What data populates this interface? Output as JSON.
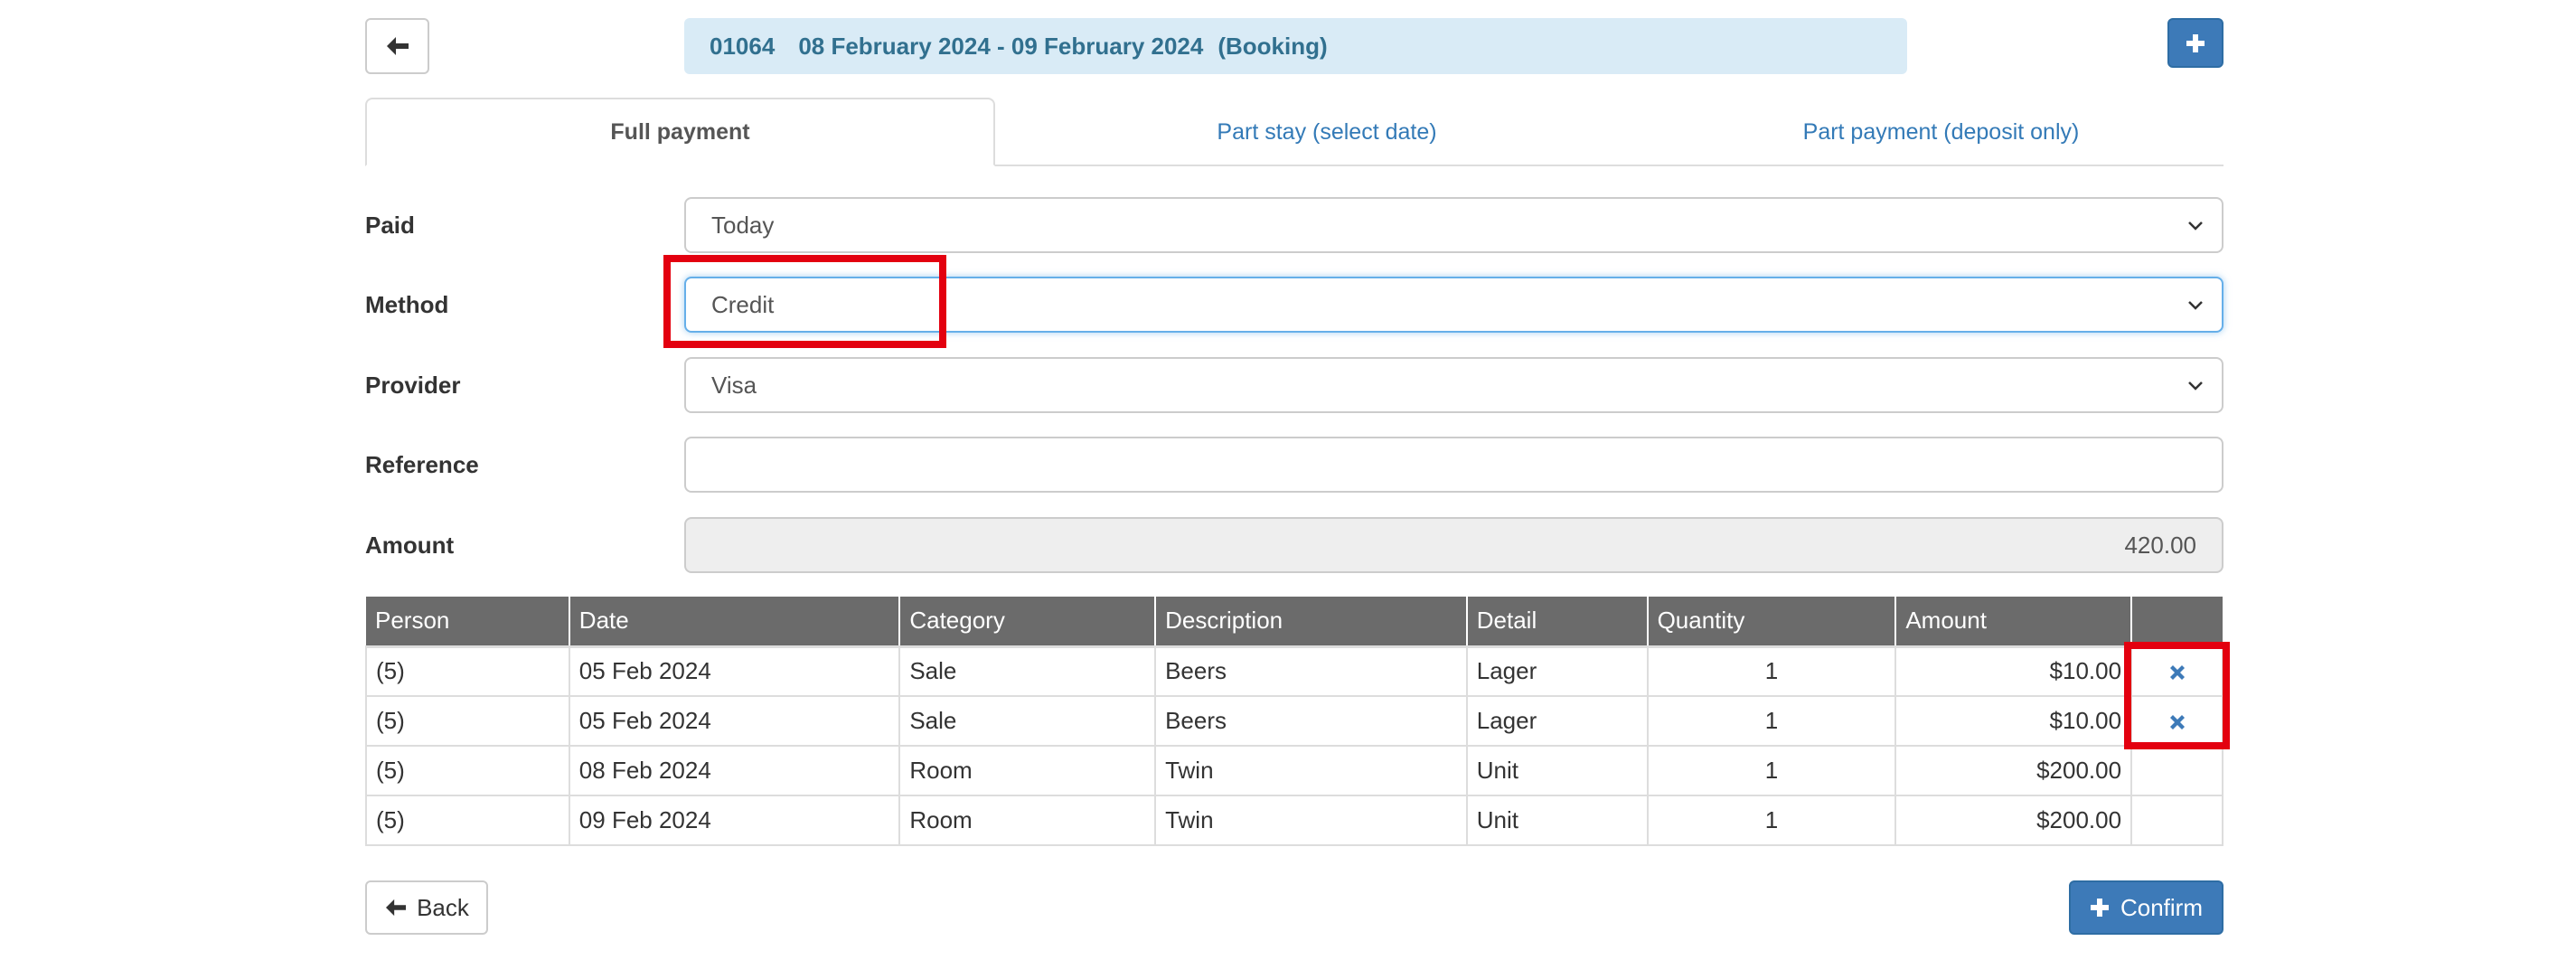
{
  "header": {
    "booking_id": "01064",
    "date_range": "08 February 2024 - 09 February 2024",
    "booking_label": "(Booking)",
    "back_icon": "arrow-left-icon",
    "add_icon": "plus-icon"
  },
  "tabs": [
    {
      "label": "Full payment",
      "active": true
    },
    {
      "label": "Part stay (select date)",
      "active": false
    },
    {
      "label": "Part payment (deposit only)",
      "active": false
    }
  ],
  "form": {
    "paid": {
      "label": "Paid",
      "value": "Today"
    },
    "method": {
      "label": "Method",
      "value": "Credit"
    },
    "provider": {
      "label": "Provider",
      "value": "Visa"
    },
    "reference": {
      "label": "Reference",
      "value": ""
    },
    "amount": {
      "label": "Amount",
      "value": "420.00"
    }
  },
  "table": {
    "columns": [
      "Person",
      "Date",
      "Category",
      "Description",
      "Detail",
      "Quantity",
      "Amount",
      ""
    ],
    "rows": [
      {
        "person": "(5)",
        "date": "05 Feb 2024",
        "category": "Sale",
        "description": "Beers",
        "detail": "Lager",
        "quantity": "1",
        "amount": "$10.00",
        "deletable": true
      },
      {
        "person": "(5)",
        "date": "05 Feb 2024",
        "category": "Sale",
        "description": "Beers",
        "detail": "Lager",
        "quantity": "1",
        "amount": "$10.00",
        "deletable": true
      },
      {
        "person": "(5)",
        "date": "08 Feb 2024",
        "category": "Room",
        "description": "Twin",
        "detail": "Unit",
        "quantity": "1",
        "amount": "$200.00",
        "deletable": false
      },
      {
        "person": "(5)",
        "date": "09 Feb 2024",
        "category": "Room",
        "description": "Twin",
        "detail": "Unit",
        "quantity": "1",
        "amount": "$200.00",
        "deletable": false
      }
    ]
  },
  "footer": {
    "back_label": "Back",
    "confirm_label": "Confirm"
  },
  "colors": {
    "primary": "#3d7ab8",
    "banner_bg": "#d9ebf6",
    "banner_text": "#31708f",
    "table_header": "#6b6b6b",
    "highlight": "#e3000f",
    "link": "#337ab7"
  }
}
